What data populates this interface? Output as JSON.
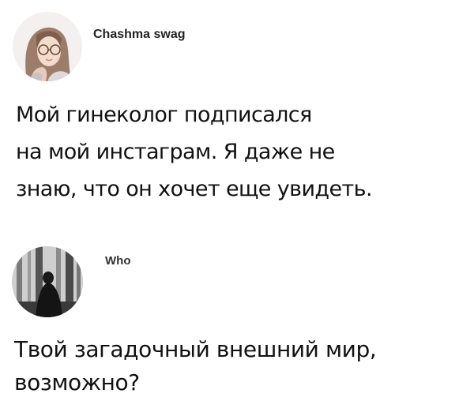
{
  "posts": [
    {
      "author": "Chashma swag",
      "avatar_icon": "girl-with-glasses-avatar",
      "text_lines": [
        "Мой гинеколог подписался",
        "на мой инстаграм. Я даже не",
        "знаю, что он хочет еще увидеть."
      ]
    },
    {
      "author": "Who",
      "avatar_icon": "dark-figure-in-forest-avatar",
      "text_lines": [
        "Твой загадочный внешний мир,",
        "возможно?"
      ]
    }
  ]
}
